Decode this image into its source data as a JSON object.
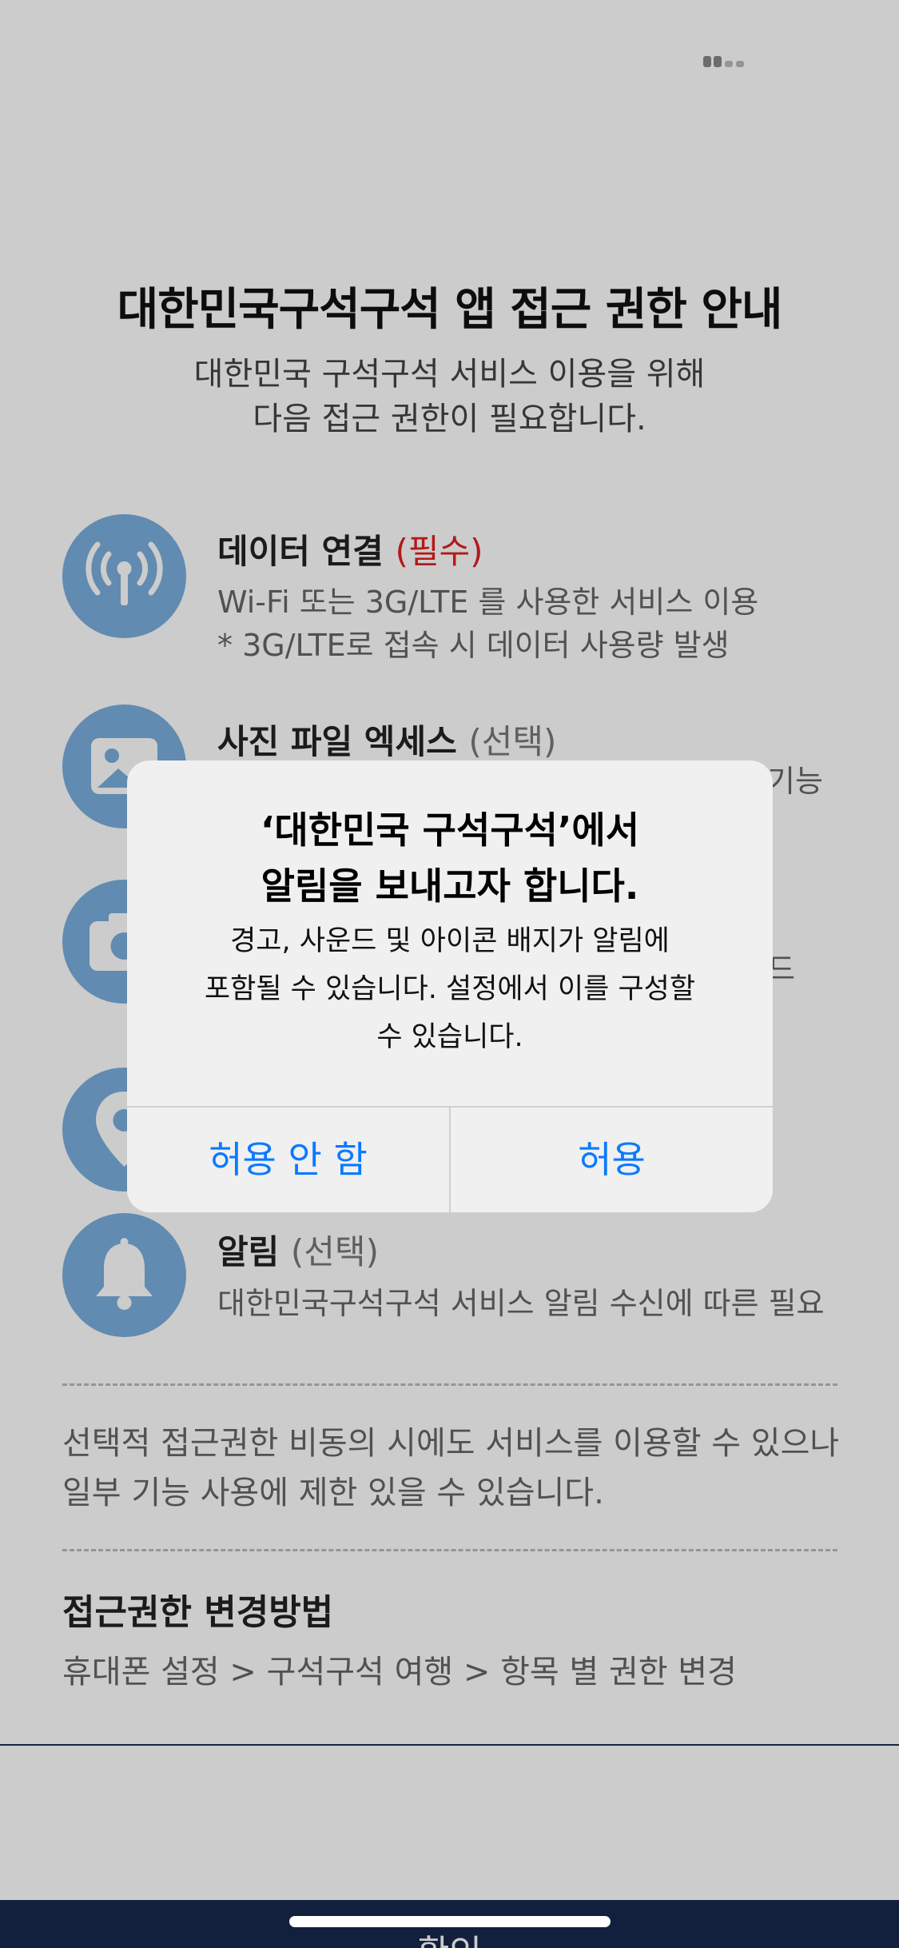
{
  "page": {
    "title": "대한민국구석구석 앱 접근 권한 안내",
    "subtitle_line1": "대한민국 구석구석 서비스 이용을 위해",
    "subtitle_line2": "다음 접근 권한이 필요합니다."
  },
  "permissions": [
    {
      "icon": "wifi-antenna-icon",
      "title": "데이터 연결",
      "tag": "(필수)",
      "desc_line1": "Wi-Fi 또는 3G/LTE 를 사용한 서비스  이용",
      "desc_line2": "* 3G/LTE로 접속 시 데이터 사용량 발생"
    },
    {
      "icon": "image-icon",
      "title": "사진 파일 엑세스",
      "tag": "(선택)",
      "desc_fragment": "기능"
    },
    {
      "icon": "camera-icon",
      "desc_fragment": "드"
    },
    {
      "icon": "location-pin-icon"
    },
    {
      "icon": "bell-icon",
      "title": "알림",
      "tag": "(선택)",
      "desc_line1": "대한민국구석구석 서비스 알림 수신에 따른 필요"
    }
  ],
  "notice": {
    "line1": "선택적 접근권한 비동의 시에도 서비스를 이용할 수 있으나",
    "line2": "일부 기능 사용에 제한 있을 수 있습니다."
  },
  "change_method": {
    "title": "접근권한 변경방법",
    "path": "휴대폰 설정 > 구석구석 여행 > 항목 별 권한 변경"
  },
  "footer": {
    "confirm_label": "확인"
  },
  "alert": {
    "title_line1": "‘대한민국 구석구석’에서",
    "title_line2": "알림을 보내고자 합니다.",
    "message_line1": "경고, 사운드 및 아이콘 배지가 알림에",
    "message_line2": "포함될 수 있습니다. 설정에서 이를 구성할",
    "message_line3": "수 있습니다.",
    "deny_label": "허용 안 함",
    "allow_label": "허용"
  },
  "colors": {
    "icon_circle": "#7aaede",
    "required_tag": "#e02020",
    "alert_button": "#0a7aff",
    "footer_bar": "#17284d"
  }
}
